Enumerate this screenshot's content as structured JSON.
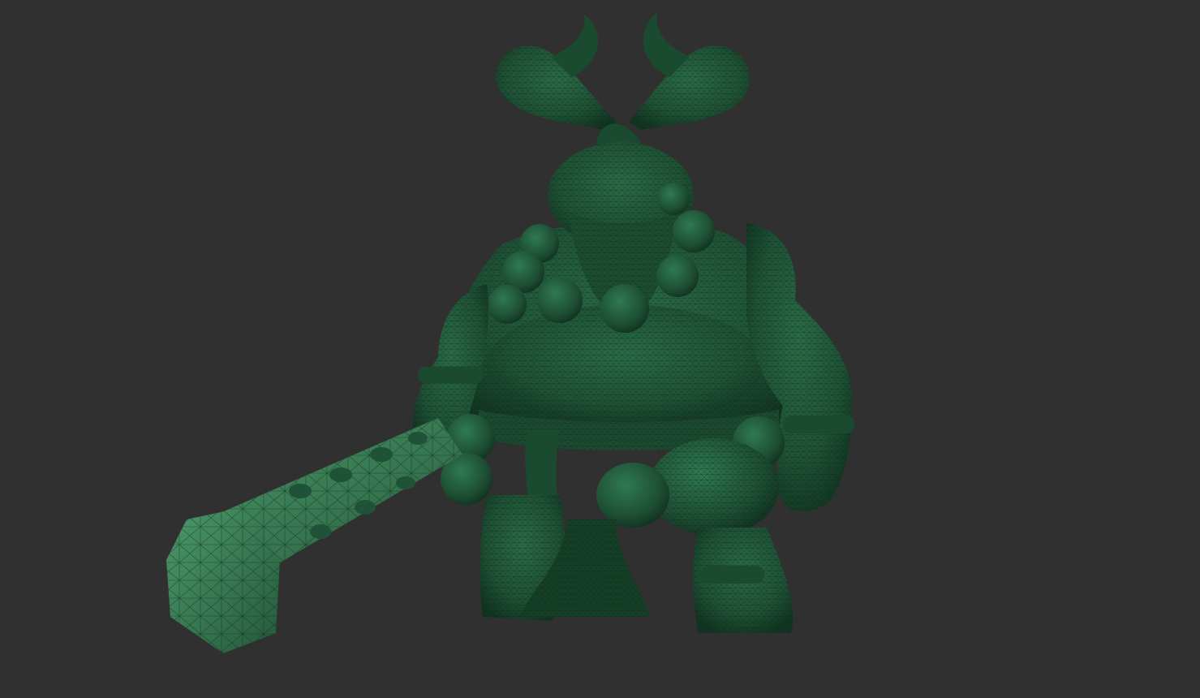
{
  "viewport": {
    "background_color": "#303030"
  },
  "model": {
    "subject": "horned-ogre-with-club",
    "display_mode": "wireframe-shaded",
    "base_color": "#1f5236",
    "shadow_color": "#10301f",
    "highlight_color": "#2f7a52",
    "wire_color": "#0b2416",
    "club_color": "#3e8c5e"
  }
}
